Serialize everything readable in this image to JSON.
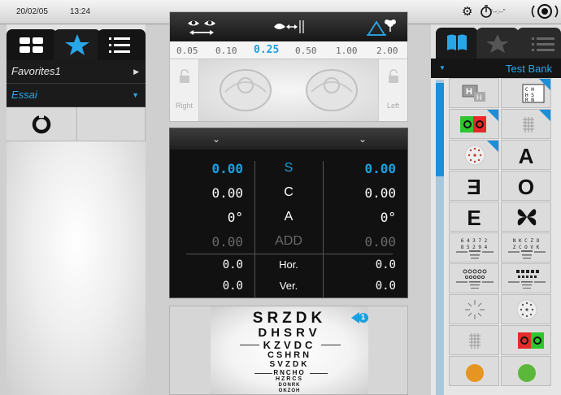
{
  "status_bar": {
    "date": "20/02/05",
    "time": "13:24",
    "timer_label": "\"--:--\""
  },
  "left_panel": {
    "tabs": [
      "grid-view",
      "favorites",
      "list-view"
    ],
    "active_tab": "favorites",
    "items": [
      {
        "label": "Favorites1",
        "selected": false
      },
      {
        "label": "Essai",
        "selected": true
      }
    ],
    "tile_icon": "landolt-c-icon"
  },
  "refraction_header": {
    "acuity_values": [
      "0.05",
      "0.10",
      "0.25",
      "0.50",
      "1.00",
      "2.00"
    ],
    "selected_acuity": "0.25",
    "right_label": "Right",
    "left_label": "Left"
  },
  "refraction_table": {
    "rows": [
      {
        "label": "S",
        "right": "0.00",
        "left": "0.00",
        "active": true
      },
      {
        "label": "C",
        "right": "0.00",
        "left": "0.00",
        "active": false
      },
      {
        "label": "A",
        "right": "0°",
        "left": "0°",
        "active": false
      },
      {
        "label": "ADD",
        "right": "0.00",
        "left": "0.00",
        "active": false,
        "disabled": true
      },
      {
        "label": "Hor.",
        "right": "0.0",
        "left": "0.0",
        "active": false
      },
      {
        "label": "Ver.",
        "right": "0.0",
        "left": "0.0",
        "active": false
      }
    ]
  },
  "chart_preview": {
    "lines": [
      "SRZDK",
      "DHSRV",
      "KZVDC",
      "CSHRN",
      "SVZDK",
      "RNCHO",
      "HZRCS",
      "DONRK",
      "OKZOH"
    ],
    "badge": "1"
  },
  "test_bank": {
    "title": "Test Bank",
    "tabs": [
      "book",
      "star",
      "list"
    ],
    "big_letters": {
      "a": "A",
      "e3": "Ǝ",
      "e": "E",
      "c": "O",
      "butterfly": "🦋"
    },
    "tiny_rows": {
      "num1": "6 4 3 7 2",
      "num2": "8 5 2 9 4",
      "letters1": "N K C Z O",
      "letters2": "Z C O V K"
    }
  },
  "colors": {
    "accent": "#1aa0e0",
    "panel_dark": "#111111",
    "background": "#cfcfcf"
  }
}
